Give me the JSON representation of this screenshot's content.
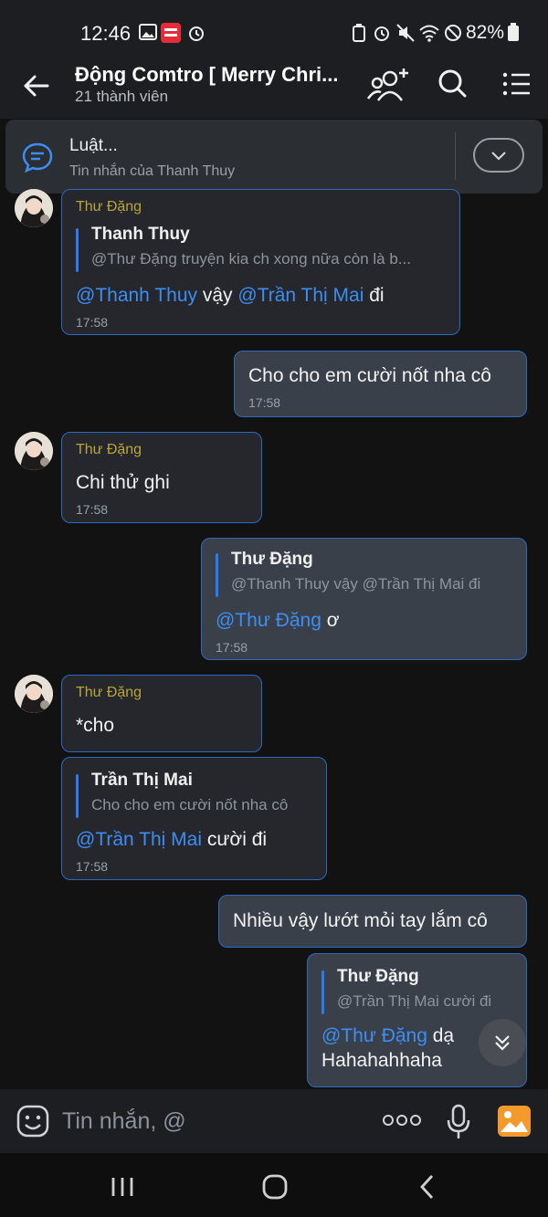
{
  "status": {
    "time": "12:46",
    "battery": "82%"
  },
  "header": {
    "title": "Động Comtro [ Merry Chri...",
    "subtitle": "21 thành viên"
  },
  "pinned": {
    "title": "Luật...",
    "subtitle": "Tin nhắn của Thanh Thuy"
  },
  "messages": {
    "m1": {
      "sender": "Thư Đặng",
      "quote_name": "Thanh Thuy",
      "quote_text": "@Thư Đặng truyện kia ch xong nữa còn là b...",
      "mention1": "@Thanh Thuy",
      "mid": " vậy ",
      "mention2": "@Trần Thị Mai",
      "tail": " đi",
      "time": "17:58"
    },
    "m2": {
      "text": "Cho cho em cười nốt nha cô",
      "time": "17:58"
    },
    "m3": {
      "sender": "Thư Đặng",
      "text": "Chi thử ghi",
      "time": "17:58"
    },
    "m4": {
      "quote_name": "Thư Đặng",
      "quote_text": "@Thanh Thuy vậy @Trần Thị Mai đi",
      "mention": "@Thư Đặng",
      "tail": " ơ",
      "time": "17:58"
    },
    "m5": {
      "sender": "Thư Đặng",
      "text": "*cho"
    },
    "m6": {
      "quote_name": "Trần Thị Mai",
      "quote_text": "Cho cho em cười nốt nha cô",
      "mention": "@Trần Thị Mai",
      "tail": " cười đi",
      "time": "17:58"
    },
    "m7": {
      "text": "Nhiều vậy lướt mỏi tay lắm cô"
    },
    "m8": {
      "quote_name": "Thư Đặng",
      "quote_text": "@Trần Thị Mai cười đi",
      "mention": "@Thư Đặng",
      "tail": " dạ",
      "line2": "Hahahahhaha"
    }
  },
  "input": {
    "placeholder": "Tin nhắn, @"
  },
  "colors": {
    "accent": "#2a7df0",
    "mention": "#3d8ef2",
    "sender": "#b9a636",
    "image_button": "#f39a2b"
  }
}
